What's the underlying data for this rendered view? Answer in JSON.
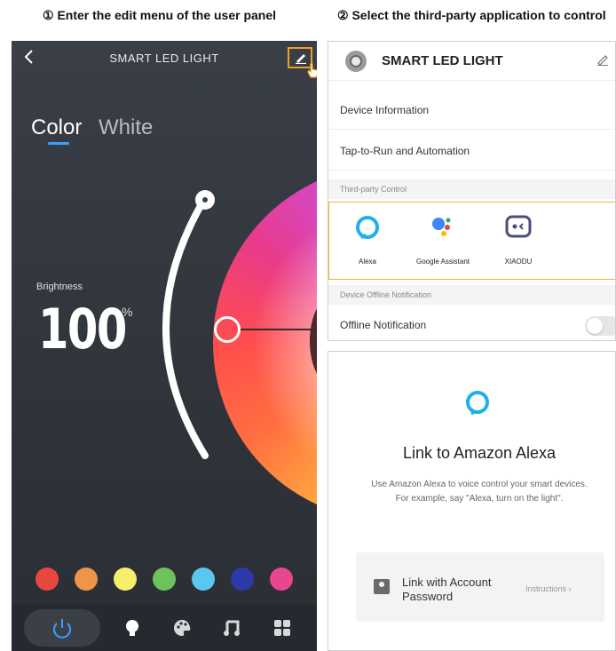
{
  "steps": {
    "step1": "① Enter the edit menu of the user panel",
    "step2": "② Select the third-party application to control"
  },
  "phone": {
    "title": "SMART LED LIGHT",
    "back_icon": "chevron-left-icon",
    "edit_icon": "pencil-icon",
    "tabs": [
      "Color",
      "White"
    ],
    "active_tab": "Color",
    "brightness_label": "Brightness",
    "brightness_value": "100",
    "brightness_unit": "%",
    "swatches": [
      "#e8473f",
      "#f0944a",
      "#f6ef6a",
      "#6cc35c",
      "#5bc6ee",
      "#2b3aa8",
      "#e8468e"
    ],
    "bottom_bar": [
      "power-icon",
      "bulb-icon",
      "palette-icon",
      "music-icon",
      "grid-icon"
    ],
    "accent": "#3aa0ff"
  },
  "settings": {
    "title": "SMART LED LIGHT",
    "rows": [
      "Device Information",
      "Tap-to-Run and Automation"
    ],
    "third_party_header": "Third-party Control",
    "apps": [
      {
        "label": "Alexa",
        "icon": "alexa-icon"
      },
      {
        "label": "Google Assistant",
        "icon": "google-assistant-icon"
      },
      {
        "label": "XIAODU",
        "icon": "xiaodu-icon"
      }
    ],
    "offline_header": "Device Offline Notification",
    "offline_row": "Offline Notification",
    "highlight": "#f0b530"
  },
  "alexa": {
    "title": "Link to Amazon Alexa",
    "desc1": "Use Amazon Alexa to voice control your smart devices.",
    "desc2": "For example, say \"Alexa, turn on the light\".",
    "account_line1": "Link with Account",
    "account_line2": "Password",
    "instructions": "Instructions",
    "brand": "#1eb0e8"
  }
}
